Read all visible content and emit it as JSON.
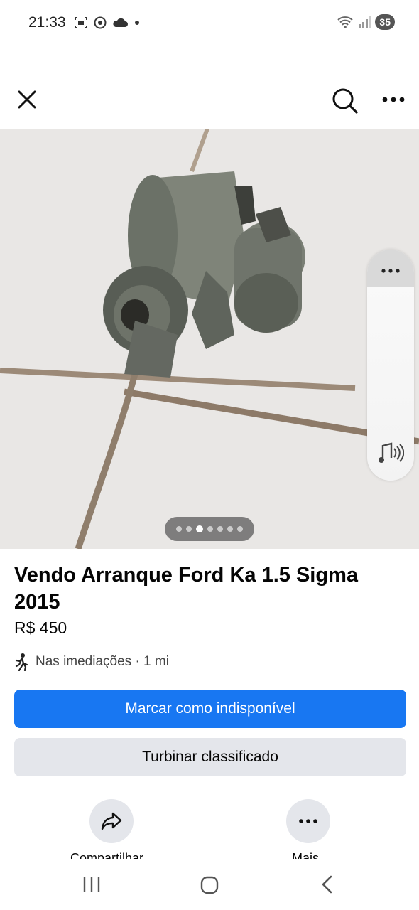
{
  "status_bar": {
    "time": "21:33",
    "battery": "35",
    "left_icons": [
      "screenshot-icon",
      "chrome-icon",
      "cloud-icon",
      "dot-icon"
    ],
    "right_icons": [
      "wifi-icon",
      "signal-icon",
      "battery-icon"
    ]
  },
  "app_bar": {
    "icons": [
      "close-icon",
      "search-icon",
      "more-horizontal-icon"
    ]
  },
  "photo": {
    "pager_count": 7,
    "pager_active_index": 2,
    "side_panel_icons": [
      "more-horizontal-icon",
      "music-sound-icon"
    ]
  },
  "listing": {
    "title": "Vendo Arranque Ford Ka 1.5 Sigma 2015",
    "price": "R$ 450",
    "location": "Nas imediações · 1 mi"
  },
  "buttons": {
    "primary": "Marcar como indisponível",
    "secondary": "Turbinar classificado"
  },
  "actions": {
    "share_label": "Compartilhar",
    "more_label": "Mais"
  },
  "nav_bar": {
    "icons": [
      "recent-apps-icon",
      "home-icon",
      "back-icon"
    ]
  },
  "colors": {
    "primary": "#1877f2",
    "secondary_bg": "#e4e6eb",
    "text": "#050505"
  }
}
